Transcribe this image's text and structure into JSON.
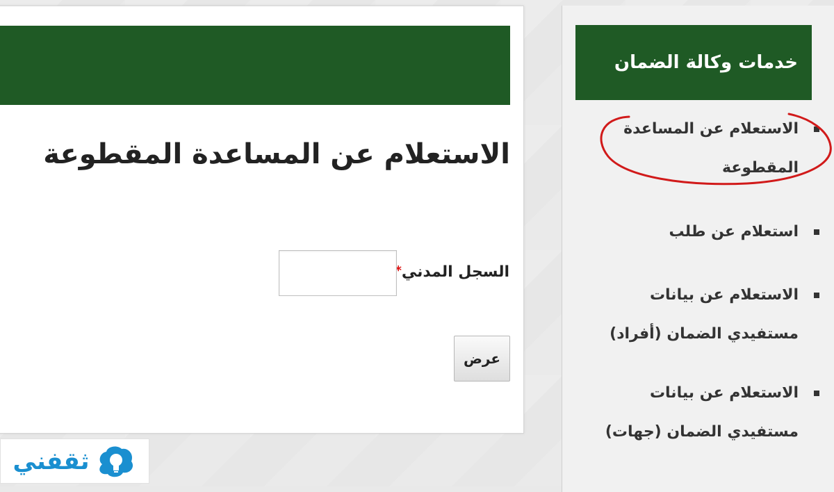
{
  "main": {
    "page_title": "الاستعلام عن المساعدة المقطوعة",
    "field_label": "السجل المدني",
    "required_mark": "*",
    "input_value": "",
    "show_button_label": "عرض"
  },
  "sidebar": {
    "header": "خدمات وكالة الضمان",
    "items": [
      {
        "line1": "الاستعلام عن المساعدة",
        "line2": "المقطوعة"
      },
      {
        "line1": "استعلام عن طلب",
        "line2": ""
      },
      {
        "line1": "الاستعلام عن بيانات",
        "line2": "مستفيدي الضمان (أفراد)"
      },
      {
        "line1": "الاستعلام عن بيانات",
        "line2": "مستفيدي الضمان (جهات)"
      }
    ]
  },
  "watermark": {
    "text": "ثقفني"
  },
  "colors": {
    "header_green": "#1f5a25",
    "highlight_red": "#d11a1a",
    "watermark_blue": "#1a8fd0"
  }
}
